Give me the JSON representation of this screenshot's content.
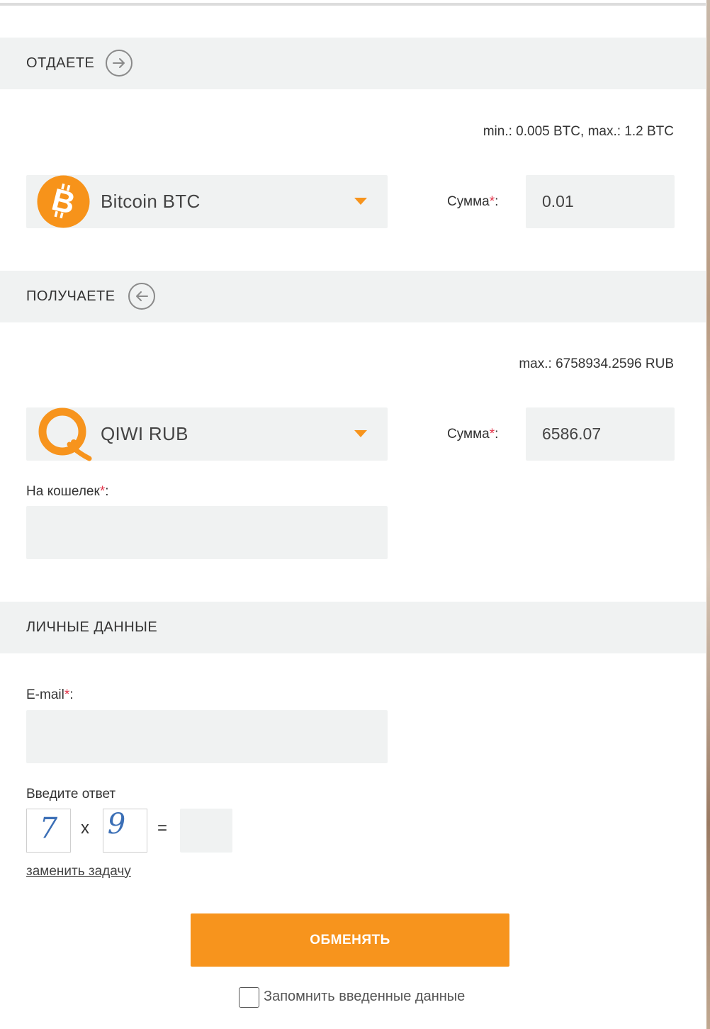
{
  "give": {
    "title": "ОТДАЕТЕ",
    "limits": "min.: 0.005 BTC, max.: 1.2 BTC",
    "currency": "Bitcoin BTC",
    "sum_label": "Сумма",
    "sum_required": "*",
    "sum_suffix": ":",
    "sum_value": "0.01"
  },
  "receive": {
    "title": "ПОЛУЧАЕТЕ",
    "limits": "max.: 6758934.2596 RUB",
    "currency": "QIWI RUB",
    "sum_label": "Сумма",
    "sum_required": "*",
    "sum_suffix": ":",
    "sum_value": "6586.07",
    "wallet_label": "На кошелек",
    "wallet_required": "*",
    "wallet_suffix": ":",
    "wallet_value": ""
  },
  "personal": {
    "title": "ЛИЧНЫЕ ДАННЫЕ",
    "email_label": "E-mail",
    "email_required": "*",
    "email_suffix": ":",
    "email_value": ""
  },
  "captcha": {
    "label": "Введите ответ",
    "digit_a": "7",
    "operator": "x",
    "digit_b": "9",
    "equals": "=",
    "answer": "",
    "replace_link": "заменить задачу"
  },
  "submit_label": "ОБМЕНЯТЬ",
  "remember_label": "Запомнить введенные данные",
  "remember_checked": false,
  "colors": {
    "accent": "#f7941d",
    "section_bg": "#f0f2f2",
    "required": "#e2344a"
  },
  "icons": {
    "give_arrow": "arrow-right-circle-icon",
    "receive_arrow": "arrow-left-circle-icon",
    "bitcoin": "bitcoin-logo-icon",
    "qiwi": "qiwi-logo-icon"
  }
}
